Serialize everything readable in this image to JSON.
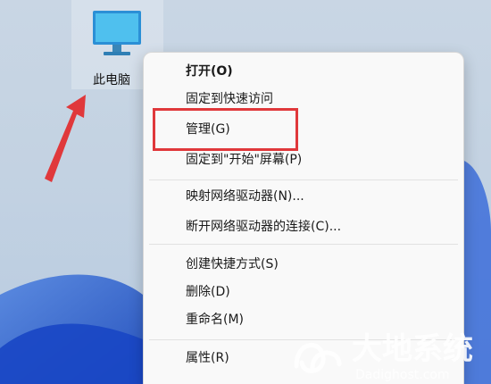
{
  "desktop": {
    "this_pc_label": "此电脑"
  },
  "context_menu": {
    "items": [
      {
        "label": "打开(O)"
      },
      {
        "label": "固定到快速访问"
      },
      {
        "label": "管理(G)"
      },
      {
        "label": "固定到\"开始\"屏幕(P)"
      },
      {
        "label": "映射网络驱动器(N)..."
      },
      {
        "label": "断开网络驱动器的连接(C)..."
      },
      {
        "label": "创建快捷方式(S)"
      },
      {
        "label": "删除(D)"
      },
      {
        "label": "重命名(M)"
      },
      {
        "label": "属性(R)"
      }
    ]
  },
  "annotations": {
    "arrow_color": "#e0383b",
    "highlight_color": "#e0383b"
  },
  "watermark": {
    "logo_text": "大地系统",
    "url": "Dadighost.com"
  }
}
